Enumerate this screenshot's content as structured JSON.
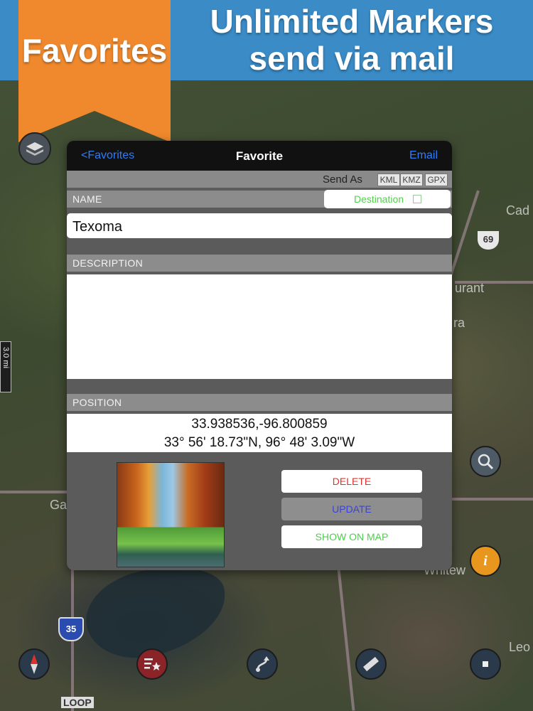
{
  "banner": {
    "ribbon_text": "Favorites",
    "title_line1": "Unlimited Markers",
    "title_line2": "send via mail"
  },
  "map": {
    "labels": [
      "Cad",
      "urant",
      "ra",
      "Ga",
      "Whitew",
      "Leo",
      "LOOP",
      "69",
      "35"
    ],
    "scale_label": "3.0 mi"
  },
  "nav": {
    "back_label": "<Favorites",
    "title": "Favorite",
    "email_label": "Email"
  },
  "send_as": {
    "label": "Send As",
    "formats": [
      "KML",
      "KMZ",
      "GPX"
    ]
  },
  "name_section": {
    "label": "NAME",
    "destination_label": "Destination",
    "destination_checked": false,
    "value": "Texoma"
  },
  "description_section": {
    "label": "DESCRIPTION",
    "value": ""
  },
  "position_section": {
    "label": "POSITION",
    "decimal": "33.938536,-96.800859",
    "dms": "33° 56' 18.73\"N, 96° 48' 3.09\"W"
  },
  "actions": {
    "delete_label": "DELETE",
    "update_label": "UPDATE",
    "show_on_map_label": "SHOW ON MAP"
  },
  "colors": {
    "banner": "#3a8bc6",
    "ribbon": "#f0892d",
    "link": "#2f7cf6",
    "delete": "#e0322a",
    "update": "#3a44d6",
    "show_on_map": "#4cd04c"
  },
  "toolbar": {
    "icons": [
      "compass-icon",
      "favorites-list-icon",
      "route-icon",
      "ruler-icon",
      "stop-icon"
    ],
    "map_side_icons": [
      "search-icon",
      "info-icon",
      "layers-icon"
    ]
  }
}
